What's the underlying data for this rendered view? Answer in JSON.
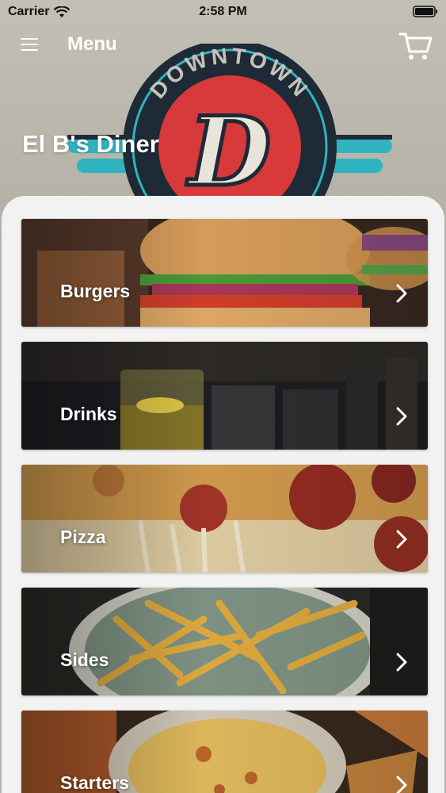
{
  "status_bar": {
    "carrier": "Carrier",
    "time": "2:58 PM"
  },
  "navbar": {
    "title": "Menu"
  },
  "restaurant": {
    "name": "El B's Diner",
    "logo_text": "DOWNTOWN",
    "logo_letter": "D"
  },
  "categories": [
    {
      "label": "Burgers"
    },
    {
      "label": "Drinks"
    },
    {
      "label": "Pizza"
    },
    {
      "label": "Sides"
    },
    {
      "label": "Starters"
    }
  ],
  "colors": {
    "accent_red": "#d8393a",
    "accent_teal": "#2fb3c1",
    "dark_navy": "#1e2a35"
  },
  "icons": [
    "hamburger-menu-icon",
    "cart-icon",
    "wifi-icon",
    "battery-icon",
    "chevron-right-icon"
  ]
}
